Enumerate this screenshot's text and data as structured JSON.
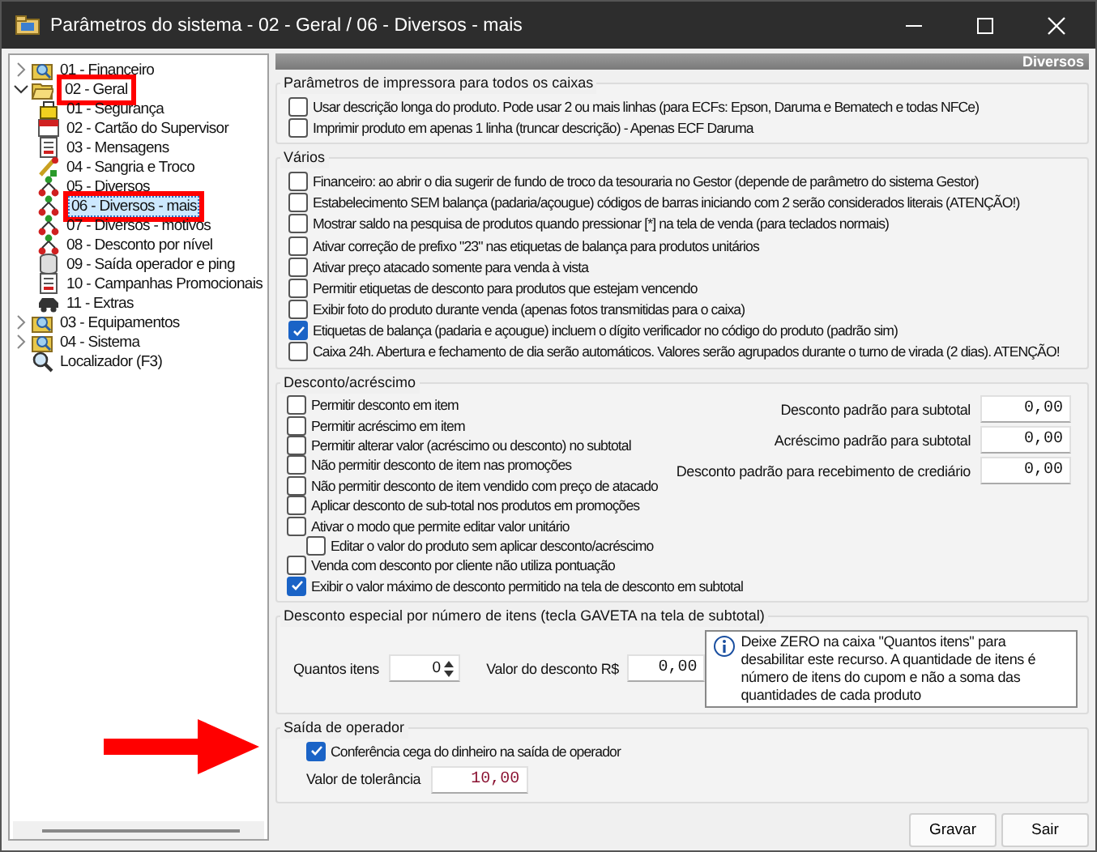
{
  "window": {
    "title": "Parâmetros do sistema - 02 - Geral / 06 - Diversos - mais"
  },
  "tree": [
    {
      "label": "01 - Financeiro",
      "kind": "folder",
      "expanded": false,
      "selected": false,
      "highlighted": false
    },
    {
      "label": "02 - Geral",
      "kind": "open-folder",
      "expanded": true,
      "selected": false,
      "highlighted": true,
      "children": [
        {
          "label": "01 - Segurança",
          "kind": "lock",
          "selected": false,
          "highlighted": false
        },
        {
          "label": "02 - Cartão do Supervisor",
          "kind": "card",
          "selected": false,
          "highlighted": false
        },
        {
          "label": "03 - Mensagens",
          "kind": "page",
          "selected": false,
          "highlighted": false
        },
        {
          "label": "04 - Sangria e Troco",
          "kind": "tools",
          "selected": false,
          "highlighted": false
        },
        {
          "label": "05 - Diversos",
          "kind": "network",
          "selected": false,
          "highlighted": false
        },
        {
          "label": "06 - Diversos - mais",
          "kind": "network",
          "selected": true,
          "highlighted": true
        },
        {
          "label": "07 - Diversos - motivos",
          "kind": "network",
          "selected": false,
          "highlighted": false
        },
        {
          "label": "08 - Desconto por nível",
          "kind": "network",
          "selected": false,
          "highlighted": false
        },
        {
          "label": "09 - Saída operador e ping",
          "kind": "database",
          "selected": false,
          "highlighted": false
        },
        {
          "label": "10 - Campanhas Promocionais",
          "kind": "page",
          "selected": false,
          "highlighted": false
        },
        {
          "label": "11 - Extras",
          "kind": "car",
          "selected": false,
          "highlighted": false
        }
      ]
    },
    {
      "label": "03 - Equipamentos",
      "kind": "folder",
      "expanded": false,
      "selected": false,
      "highlighted": false
    },
    {
      "label": "04 - Sistema",
      "kind": "folder",
      "expanded": false,
      "selected": false,
      "highlighted": false
    },
    {
      "label": "Localizador (F3)",
      "kind": "search",
      "selected": false,
      "highlighted": false
    }
  ],
  "header": "Diversos",
  "printer_group": {
    "title": "Parâmetros de impressora para todos os caixas",
    "options": [
      {
        "label": "Usar descrição longa do produto. Pode usar 2 ou mais linhas (para ECFs: Epson, Daruma e Bematech e todas NFCe)",
        "checked": false
      },
      {
        "label": "Imprimir produto em apenas 1 linha (truncar descrição) - Apenas ECF Daruma",
        "checked": false
      }
    ]
  },
  "various_group": {
    "title": "Vários",
    "options": [
      {
        "label": "Financeiro: ao abrir o dia sugerir de fundo de troco da tesouraria no Gestor  (depende de parâmetro do sistema Gestor)",
        "checked": false
      },
      {
        "label": "Estabelecimento SEM balança (padaria/açougue) códigos de barras iniciando com 2 serão considerados literais (ATENÇÃO!)",
        "checked": false
      },
      {
        "label": "Mostrar saldo na pesquisa de produtos quando pressionar [*] na tela de venda (para teclados normais)",
        "checked": false
      },
      {
        "label": "Ativar correção de prefixo \"23\" nas etiquetas de balança para produtos unitários",
        "checked": false
      },
      {
        "label": "Ativar preço atacado somente para venda à vista",
        "checked": false
      },
      {
        "label": "Permitir etiquetas de desconto para produtos que estejam vencendo",
        "checked": false
      },
      {
        "label": "Exibir foto do produto durante venda (apenas fotos transmitidas para o caixa)",
        "checked": false
      },
      {
        "label": "Etiquetas de balança (padaria e açougue) incluem o dígito verificador no código do produto (padrão sim)",
        "checked": true
      },
      {
        "label": "Caixa 24h. Abertura e fechamento de dia serão automáticos. Valores serão agrupados durante o turno de virada (2 dias). ATENÇÃO!",
        "checked": false
      }
    ]
  },
  "discount_group": {
    "title": "Desconto/acréscimo",
    "options": [
      {
        "label": "Permitir desconto em item",
        "checked": false
      },
      {
        "label": "Permitir acréscimo em item",
        "checked": false
      },
      {
        "label": "Permitir alterar valor (acréscimo ou desconto) no subtotal",
        "checked": false
      },
      {
        "label": "Não permitir desconto de item nas promoções",
        "checked": false
      },
      {
        "label": "Não permitir desconto de item vendido com preço de atacado",
        "checked": false
      },
      {
        "label": "Aplicar desconto de sub-total nos produtos em promoções",
        "checked": false
      },
      {
        "label": "Ativar o modo que permite editar valor unitário",
        "checked": false,
        "children": [
          {
            "label": "Editar o valor do produto sem aplicar desconto/acréscimo",
            "checked": false
          }
        ]
      },
      {
        "label": "Venda com desconto por cliente não utiliza pontuação",
        "checked": false
      },
      {
        "label": "Exibir o valor máximo de desconto permitido na tela de desconto em subtotal",
        "checked": true
      }
    ],
    "fields": [
      {
        "label": "Desconto padrão para subtotal",
        "value": "0,00"
      },
      {
        "label": "Acréscimo padrão para subtotal",
        "value": "0,00"
      },
      {
        "label": "Desconto padrão para recebimento de crediário",
        "value": "0,00"
      }
    ]
  },
  "special_group": {
    "title": "Desconto especial por número de itens (tecla GAVETA na tela de subtotal)",
    "quantity": {
      "label": "Quantos itens",
      "value": "0"
    },
    "amount": {
      "label": "Valor do desconto R$",
      "value": "0,00"
    },
    "note": "Deixe ZERO na caixa \"Quantos itens\" para desabilitar este recurso. A quantidade de itens é número de itens do cupom e não a soma das quantidades de cada produto"
  },
  "operator_group": {
    "title": "Saída de operador",
    "option": {
      "label": "Conferência cega do dinheiro na saída de operador",
      "checked": true
    },
    "field": {
      "label": "Valor de tolerância",
      "value": "10,00"
    }
  },
  "buttons": [
    "Gravar",
    "Sair"
  ]
}
